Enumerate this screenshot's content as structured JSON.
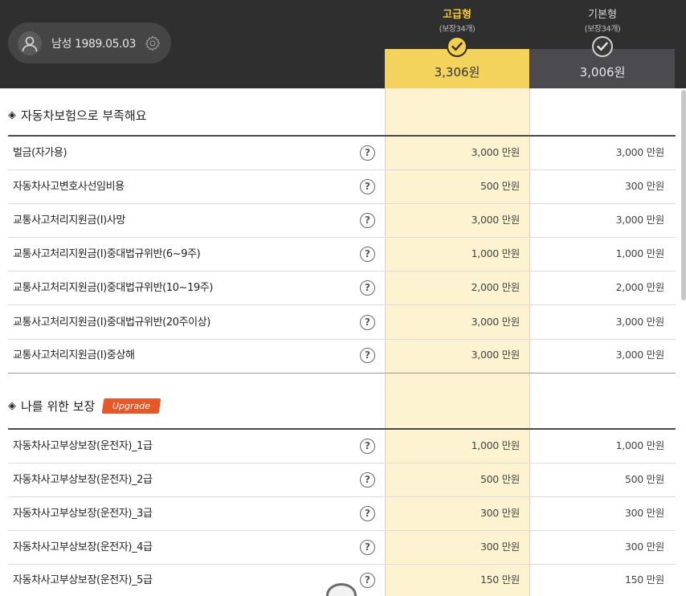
{
  "header": {
    "profile": {
      "text": "남성 1989.05.03"
    },
    "plans": [
      {
        "name": "고급형",
        "sub": "(보장34개)",
        "price": "3,306원"
      },
      {
        "name": "기본형",
        "sub": "(보장34개)",
        "price": "3,006원"
      }
    ]
  },
  "sections": [
    {
      "title": "자동차보험으로 부족해요",
      "rows": [
        {
          "label": "벌금(자가용)",
          "premium": "3,000 만원",
          "basic": "3,000 만원"
        },
        {
          "label": "자동차사고변호사선임비용",
          "premium": "500 만원",
          "basic": "300 만원"
        },
        {
          "label": "교통사고처리지원금(I)사망",
          "premium": "3,000 만원",
          "basic": "3,000 만원"
        },
        {
          "label": "교통사고처리지원금(I)중대법규위반(6~9주)",
          "premium": "1,000 만원",
          "basic": "1,000 만원"
        },
        {
          "label": "교통사고처리지원금(I)중대법규위반(10~19주)",
          "premium": "2,000 만원",
          "basic": "2,000 만원"
        },
        {
          "label": "교통사고처리지원금(I)중대법규위반(20주이상)",
          "premium": "3,000 만원",
          "basic": "3,000 만원"
        },
        {
          "label": "교통사고처리지원금(I)중상해",
          "premium": "3,000 만원",
          "basic": "3,000 만원"
        }
      ]
    },
    {
      "title": "나를 위한 보장",
      "badge": "Upgrade",
      "rows": [
        {
          "label": "자동차사고부상보장(운전자)_1급",
          "premium": "1,000 만원",
          "basic": "1,000 만원"
        },
        {
          "label": "자동차사고부상보장(운전자)_2급",
          "premium": "500 만원",
          "basic": "500 만원"
        },
        {
          "label": "자동차사고부상보장(운전자)_3급",
          "premium": "300 만원",
          "basic": "300 만원"
        },
        {
          "label": "자동차사고부상보장(운전자)_4급",
          "premium": "300 만원",
          "basic": "300 만원"
        },
        {
          "label": "자동차사고부상보장(운전자)_5급",
          "premium": "150 만원",
          "basic": "150 만원"
        }
      ]
    }
  ],
  "symbols": {
    "diamond": "◈",
    "help": "?"
  },
  "colors": {
    "premium_accent": "#f3d35c",
    "premium_band": "#fdf3d1",
    "header_bg": "#2f2f2f",
    "badge": "#e4582a"
  },
  "icons": [
    "user-avatar-icon",
    "gear-icon",
    "check-icon",
    "question-icon",
    "diamond-icon"
  ]
}
